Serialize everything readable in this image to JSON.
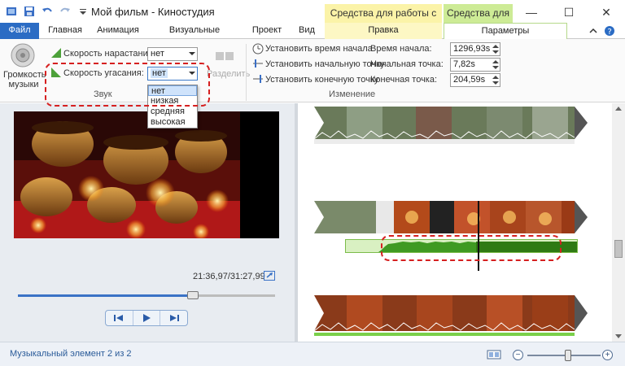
{
  "window": {
    "title": "Мой фильм - Киностудия",
    "contextual_video": "Средства для работы с видео",
    "contextual_music": "Средства для ...",
    "minimize_glyph": "—",
    "maximize_glyph": "☐",
    "close_glyph": "✕"
  },
  "tabs": {
    "file": "Файл",
    "home": "Главная",
    "animation": "Анимация",
    "visual_effects": "Визуальные эффекты",
    "project": "Проект",
    "view": "Вид",
    "edit": "Правка",
    "params": "Параметры"
  },
  "ribbon": {
    "music_volume": "Громкость музыки",
    "fade_in_label": "Скорость нарастания:",
    "fade_in_value": "нет",
    "fade_out_label": "Скорость угасания:",
    "fade_out_value": "нет",
    "fade_out_options": [
      "нет",
      "низкая",
      "средняя",
      "высокая"
    ],
    "split": "Разделить",
    "sound_group": "Звук",
    "set_start_time": "Установить время начала",
    "set_start_point": "Установить начальную точку",
    "set_end_point": "Установить конечную точку",
    "start_time_label": "Время начала:",
    "start_time_value": "1296,93s",
    "start_point_label": "Начальная точка:",
    "start_point_value": "7,82s",
    "end_point_label": "Конечная точка:",
    "end_point_value": "204,59s",
    "change_group": "Изменение"
  },
  "preview": {
    "time": "21:36,97/31:27,99",
    "seek_progress": 0.69
  },
  "status": {
    "text": "Музыкальный элемент 2 из 2",
    "zoom_minus": "−",
    "zoom_plus": "+"
  },
  "colors": {
    "file_tab": "#2b6cc4",
    "video_tools": "#fbf3a8",
    "music_tools": "#cdeb96",
    "waveform": "#3f9a22",
    "highlight_dash": "#d62020"
  }
}
